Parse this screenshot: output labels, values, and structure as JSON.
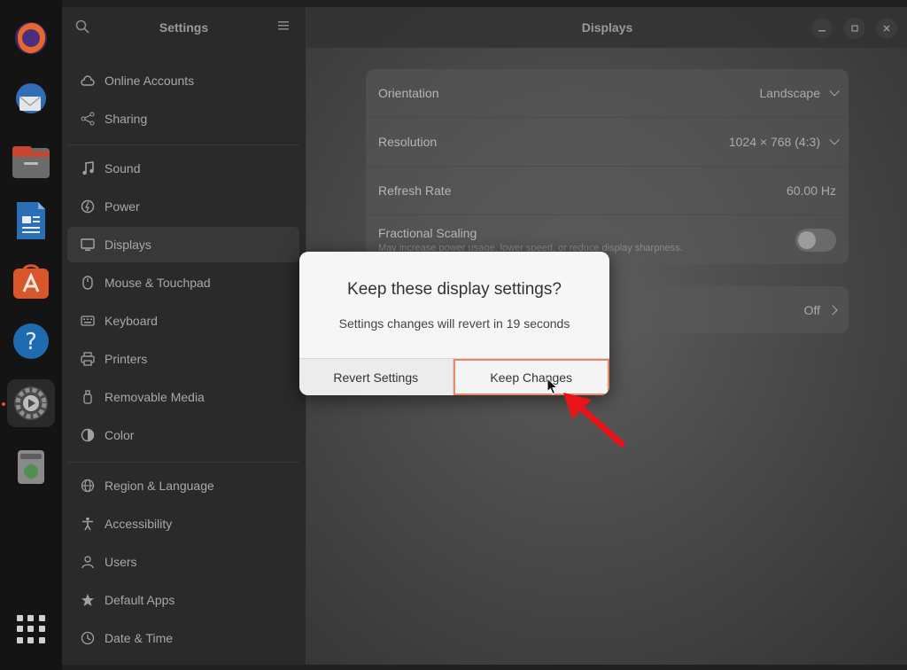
{
  "dock": {
    "items": [
      {
        "name": "firefox-icon"
      },
      {
        "name": "thunderbird-icon"
      },
      {
        "name": "files-icon"
      },
      {
        "name": "writer-icon"
      },
      {
        "name": "app-center-icon"
      },
      {
        "name": "help-icon"
      },
      {
        "name": "settings-icon"
      },
      {
        "name": "trash-icon"
      }
    ]
  },
  "sidebar": {
    "title": "Settings",
    "items": [
      {
        "label": "Online Accounts",
        "icon": "cloud-icon"
      },
      {
        "label": "Sharing",
        "icon": "share-icon"
      },
      {
        "label": "Sound",
        "icon": "music-note-icon"
      },
      {
        "label": "Power",
        "icon": "power-icon"
      },
      {
        "label": "Displays",
        "icon": "monitor-icon"
      },
      {
        "label": "Mouse & Touchpad",
        "icon": "mouse-icon"
      },
      {
        "label": "Keyboard",
        "icon": "keyboard-icon"
      },
      {
        "label": "Printers",
        "icon": "printer-icon"
      },
      {
        "label": "Removable Media",
        "icon": "usb-icon"
      },
      {
        "label": "Color",
        "icon": "color-icon"
      },
      {
        "label": "Region & Language",
        "icon": "globe-icon"
      },
      {
        "label": "Accessibility",
        "icon": "accessibility-icon"
      },
      {
        "label": "Users",
        "icon": "users-icon"
      },
      {
        "label": "Default Apps",
        "icon": "star-icon"
      },
      {
        "label": "Date & Time",
        "icon": "clock-icon"
      }
    ]
  },
  "main": {
    "title": "Displays",
    "orientation": {
      "label": "Orientation",
      "value": "Landscape"
    },
    "resolution": {
      "label": "Resolution",
      "value": "1024 × 768 (4:3)"
    },
    "refresh_rate": {
      "label": "Refresh Rate",
      "value": "60.00 Hz"
    },
    "fractional_scaling": {
      "label": "Fractional Scaling",
      "sub": "May increase power usage, lower speed, or reduce display sharpness."
    },
    "night_light": {
      "value": "Off"
    }
  },
  "dialog": {
    "title": "Keep these display settings?",
    "body": "Settings changes will revert in 19 seconds",
    "revert_label": "Revert Settings",
    "keep_label": "Keep Changes"
  },
  "colors": {
    "accent": "#e95420",
    "arrow": "#e8141a"
  }
}
